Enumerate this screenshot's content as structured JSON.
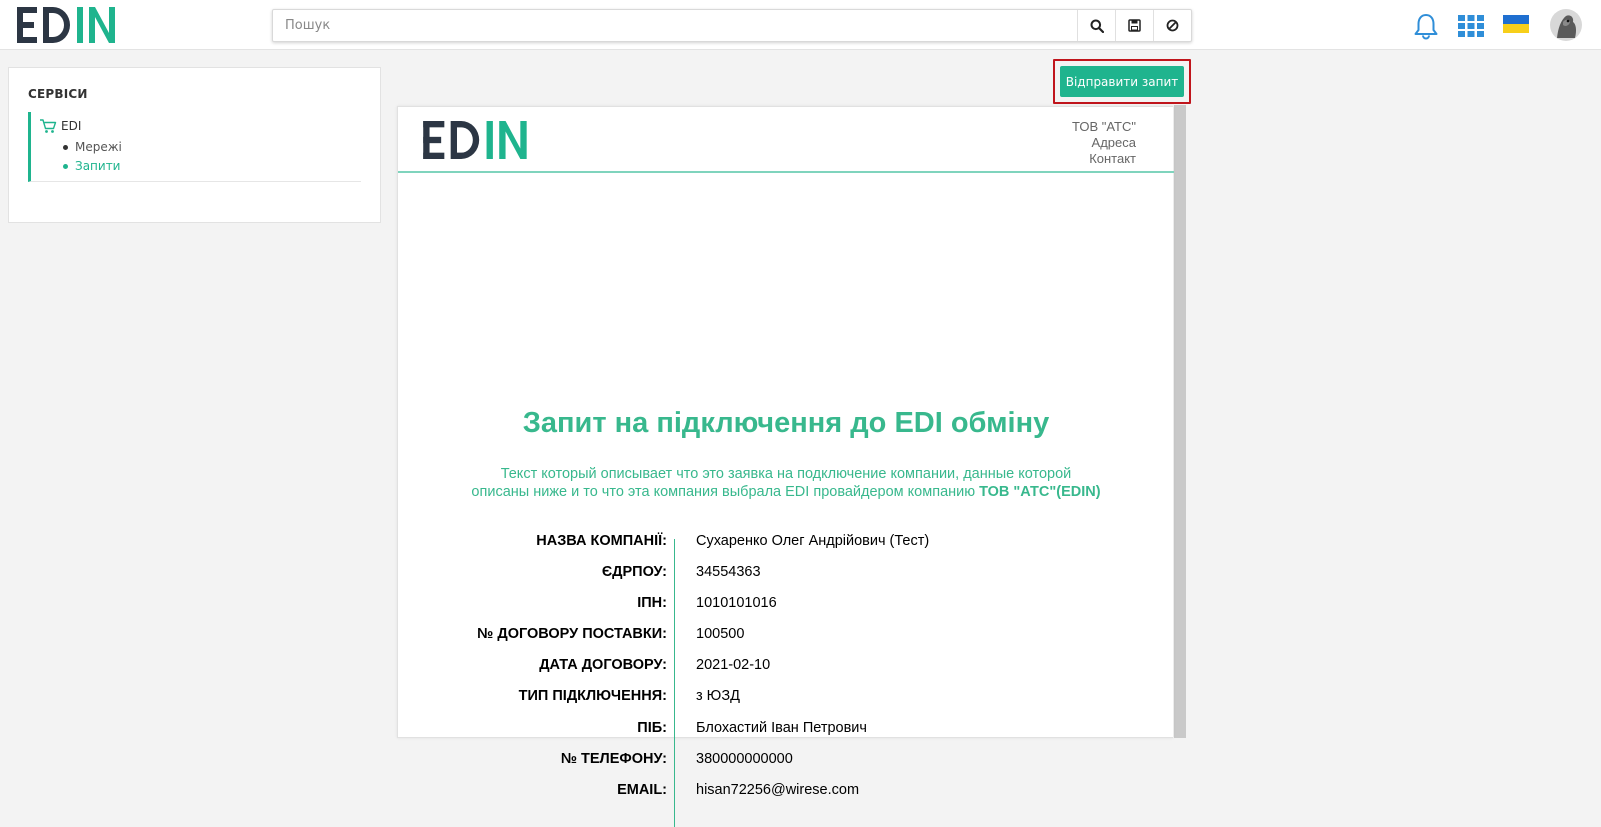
{
  "app": {
    "brand": "EDIN",
    "search_placeholder": "Пошук"
  },
  "icons": {
    "search": "search-icon",
    "save": "save-icon",
    "clear": "block-icon",
    "notifications": "bell-icon",
    "apps": "grid-icon",
    "language": "ukraine-flag-icon",
    "user": "avatar"
  },
  "colors": {
    "accent": "#1fb48e",
    "doc_accent": "#38b88d",
    "highlight_border": "#c0151c",
    "brand_dark": "#2c3644"
  },
  "sidebar": {
    "title": "СЕРВІСИ",
    "service": "EDI",
    "items": [
      {
        "label": "Мережі"
      },
      {
        "label": "Запити"
      }
    ]
  },
  "toolbar": {
    "send_label": "Відправити запит"
  },
  "document": {
    "company": "ТОВ \"АТС\"",
    "address": "Адреса",
    "contact": "Контакт",
    "title": "Запит на підключення до EDI обміну",
    "desc_line1": "Текст который описывает что это заявка на подключение компании, данные которой",
    "desc_line2": "описаны ниже и то что эта компания выбрала EDI провайдером компанию",
    "desc_company": "ТОВ \"АТС\"(EDIN)",
    "fields": [
      {
        "label": "НАЗВА КОМПАНІЇ:",
        "value": "Сухаренко Олег Андрійович (Тест)"
      },
      {
        "label": "ЄДРПОУ:",
        "value": "34554363"
      },
      {
        "label": "ІПН:",
        "value": "1010101016"
      },
      {
        "label": "№ ДОГОВОРУ ПОСТАВКИ:",
        "value": "100500"
      },
      {
        "label": "ДАТА ДОГОВОРУ:",
        "value": "2021-02-10"
      },
      {
        "label": "ТИП ПІДКЛЮЧЕННЯ:",
        "value": "з ЮЗД"
      },
      {
        "label": "ПІБ:",
        "value": "Блохастий Іван Петрович"
      },
      {
        "label": "№ ТЕЛЕФОНУ:",
        "value": "380000000000"
      },
      {
        "label": "EMAIL:",
        "value": "hisan72256@wirese.com"
      }
    ]
  }
}
